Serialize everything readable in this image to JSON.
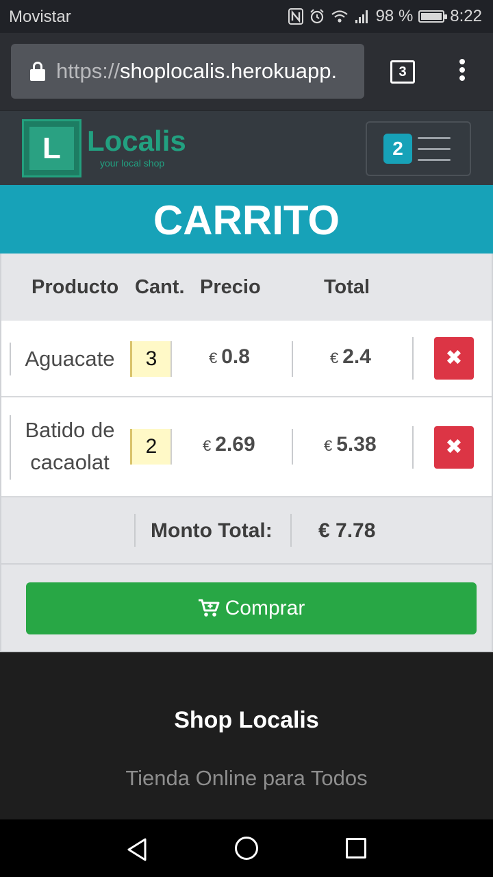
{
  "status_bar": {
    "carrier": "Movistar",
    "battery": "98 %",
    "battery_level": 0.98,
    "time": "8:22",
    "icons": [
      "nfc-icon",
      "alarm-icon",
      "wifi-icon",
      "signal-icon",
      "battery-icon"
    ]
  },
  "browser": {
    "url_scheme": "https://",
    "url_host": "shoplocalis.herokuapp.",
    "tab_count": "3"
  },
  "navbar": {
    "logo_letter": "L",
    "logo_name": "Localis",
    "logo_tagline": "your local shop",
    "cart_count": "2"
  },
  "page": {
    "banner_title": "CARRITO"
  },
  "cart": {
    "headers": {
      "product": "Producto",
      "quantity": "Cant.",
      "price": "Precio",
      "total": "Total"
    },
    "currency": "€",
    "items": [
      {
        "name": "Aguacate",
        "quantity": "3",
        "price": "0.8",
        "total": "2.4",
        "delete_label": "✖"
      },
      {
        "name": "Batido de cacaolat",
        "quantity": "2",
        "price": "2.69",
        "total": "5.38",
        "delete_label": "✖"
      }
    ],
    "total_label": "Monto Total:",
    "total_value": "€ 7.78",
    "buy_label": "Comprar"
  },
  "footer": {
    "title": "Shop Localis",
    "subtitle": "Tienda Online para Todos"
  },
  "colors": {
    "accent": "#17a2b8",
    "buy": "#28a745",
    "danger": "#dc3545",
    "brand": "#22a080"
  }
}
